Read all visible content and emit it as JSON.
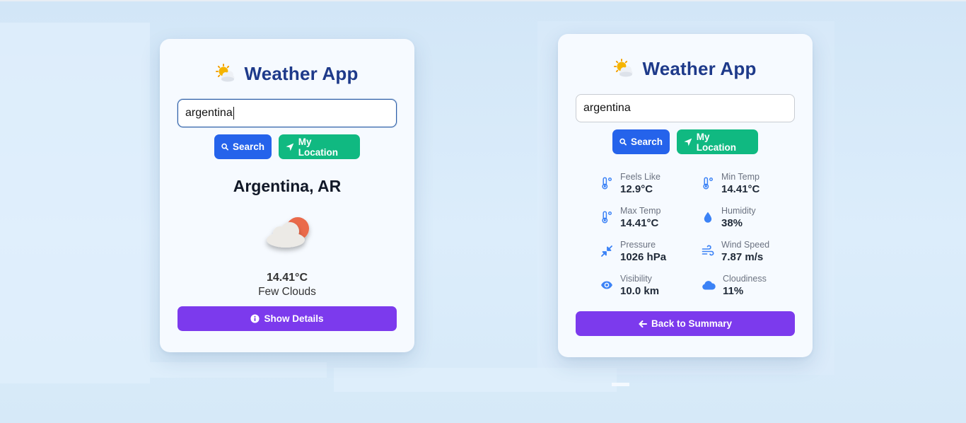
{
  "summary_card": {
    "title": "Weather App",
    "title_icon": "sun-behind-cloud-icon",
    "search": {
      "value": "argentina",
      "placeholder": ""
    },
    "search_button": "Search",
    "location_button": "My Location",
    "city": "Argentina, AR",
    "weather_icon": "few-clouds-icon",
    "temperature": "14.41°C",
    "description": "Few Clouds",
    "details_button": "Show Details"
  },
  "details_card": {
    "title": "Weather App",
    "title_icon": "sun-behind-cloud-icon",
    "search": {
      "value": "argentina",
      "placeholder": ""
    },
    "search_button": "Search",
    "location_button": "My Location",
    "details": [
      {
        "icon": "thermometer-icon",
        "label": "Feels Like",
        "value": "12.9°C"
      },
      {
        "icon": "thermometer-icon",
        "label": "Min Temp",
        "value": "14.41°C"
      },
      {
        "icon": "thermometer-icon",
        "label": "Max Temp",
        "value": "14.41°C"
      },
      {
        "icon": "droplet-icon",
        "label": "Humidity",
        "value": "38%"
      },
      {
        "icon": "compress-arrows-icon",
        "label": "Pressure",
        "value": "1026 hPa"
      },
      {
        "icon": "wind-icon",
        "label": "Wind Speed",
        "value": "7.87 m/s"
      },
      {
        "icon": "eye-icon",
        "label": "Visibility",
        "value": "10.0 km"
      },
      {
        "icon": "cloud-icon",
        "label": "Cloudiness",
        "value": "11%"
      }
    ],
    "back_button": "Back to Summary"
  },
  "colors": {
    "title": "#1e3a8a",
    "search_button": "#2563eb",
    "location_button": "#10b981",
    "action_button": "#7c3aed",
    "detail_icon": "#3b82f6"
  }
}
